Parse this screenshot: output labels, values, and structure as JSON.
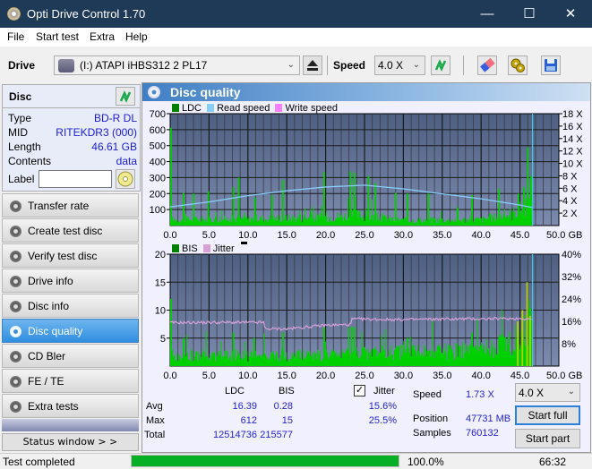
{
  "window": {
    "title": "Opti Drive Control 1.70",
    "minimize": "—",
    "maximize": "☐",
    "close": "✕"
  },
  "menu": [
    "File",
    "Start test",
    "Extra",
    "Help"
  ],
  "toolbar": {
    "drive_label": "Drive",
    "drive_value": "(I:)  ATAPI iHBS312   2 PL17",
    "speed_label": "Speed",
    "speed_value": "4.0 X"
  },
  "disc": {
    "header": "Disc",
    "fields": [
      {
        "key": "Type",
        "value": "BD-R DL"
      },
      {
        "key": "MID",
        "value": "RITEKDR3 (000)"
      },
      {
        "key": "Length",
        "value": "46.61 GB"
      },
      {
        "key": "Contents",
        "value": "data"
      }
    ],
    "label_key": "Label",
    "label_value": ""
  },
  "nav": [
    {
      "label": "Transfer rate",
      "active": false
    },
    {
      "label": "Create test disc",
      "active": false
    },
    {
      "label": "Verify test disc",
      "active": false
    },
    {
      "label": "Drive info",
      "active": false
    },
    {
      "label": "Disc info",
      "active": false
    },
    {
      "label": "Disc quality",
      "active": true
    },
    {
      "label": "CD Bler",
      "active": false
    },
    {
      "label": "FE / TE",
      "active": false
    },
    {
      "label": "Extra tests",
      "active": false
    }
  ],
  "status_window_button": "Status window > >",
  "panel_title": "Disc quality",
  "colors": {
    "ldc": "#008000",
    "bis": "#008000",
    "read_speed": "#87cefa",
    "write_speed": "#ff80ff",
    "jitter": "#d8a0d8",
    "bar_green": "#00d000",
    "plot_bg_top": "#4d5f82",
    "plot_bg_bottom": "#7c8bb0",
    "progress": "#06b025"
  },
  "chart_data": [
    {
      "type": "area",
      "title": "LDC / Read speed",
      "legend": [
        "LDC",
        "Read speed",
        "Write speed"
      ],
      "legend_position": "top-left",
      "xlabel": "GB",
      "x_ticks": [
        "0.0",
        "5.0",
        "10.0",
        "15.0",
        "20.0",
        "25.0",
        "30.0",
        "35.0",
        "40.0",
        "45.0",
        "50.0 GB"
      ],
      "xlim": [
        0,
        50
      ],
      "y_ticks": [
        "700",
        "600",
        "500",
        "400",
        "300",
        "200",
        "100"
      ],
      "ylim": [
        0,
        700
      ],
      "y2_ticks": [
        "18 X",
        "16 X",
        "14 X",
        "12 X",
        "10 X",
        "8 X",
        "6 X",
        "4 X",
        "2 X"
      ],
      "y2lim": [
        0,
        18
      ],
      "grid": true,
      "end_marker_gb": 46.61,
      "ldc_peaks": [
        [
          0.1,
          612
        ],
        [
          1.7,
          205
        ],
        [
          3.0,
          200
        ],
        [
          4.9,
          215
        ],
        [
          8.1,
          240
        ],
        [
          8.8,
          300
        ],
        [
          10.9,
          175
        ],
        [
          13.1,
          190
        ],
        [
          14.5,
          285
        ],
        [
          19.8,
          335
        ],
        [
          23.2,
          340
        ],
        [
          23.7,
          330
        ],
        [
          25.5,
          310
        ],
        [
          26.4,
          265
        ],
        [
          29.0,
          205
        ],
        [
          30.5,
          200
        ],
        [
          33.2,
          200
        ],
        [
          38.8,
          190
        ],
        [
          42.3,
          230
        ],
        [
          44.8,
          200
        ],
        [
          45.5,
          240
        ],
        [
          46.0,
          490
        ],
        [
          46.4,
          310
        ]
      ],
      "ldc_baseline": [
        [
          0,
          40
        ],
        [
          10,
          45
        ],
        [
          20,
          55
        ],
        [
          24,
          70
        ],
        [
          30,
          35
        ],
        [
          40,
          40
        ],
        [
          44,
          80
        ],
        [
          46.6,
          160
        ]
      ],
      "read_speed": [
        [
          0,
          3.0
        ],
        [
          5,
          3.8
        ],
        [
          10,
          4.8
        ],
        [
          15,
          5.6
        ],
        [
          20,
          6.2
        ],
        [
          25,
          6.5
        ],
        [
          30,
          5.9
        ],
        [
          35,
          5.1
        ],
        [
          40,
          4.3
        ],
        [
          45,
          3.3
        ],
        [
          46.6,
          2.9
        ]
      ]
    },
    {
      "type": "area",
      "title": "BIS / Jitter",
      "legend": [
        "BIS",
        "Jitter"
      ],
      "legend_position": "top-left",
      "xlabel": "GB",
      "x_ticks": [
        "0.0",
        "5.0",
        "10.0",
        "15.0",
        "20.0",
        "25.0",
        "30.0",
        "35.0",
        "40.0",
        "45.0",
        "50.0 GB"
      ],
      "xlim": [
        0,
        50
      ],
      "y_ticks": [
        "20",
        "15",
        "10",
        "5"
      ],
      "ylim": [
        0,
        20
      ],
      "y2_ticks": [
        "40%",
        "32%",
        "24%",
        "16%",
        "8%"
      ],
      "y2lim": [
        0,
        40
      ],
      "grid": true,
      "end_marker_gb": 46.61,
      "bis_peaks": [
        [
          0.1,
          12
        ],
        [
          1.7,
          5
        ],
        [
          8.1,
          6
        ],
        [
          10.8,
          5
        ],
        [
          14.5,
          6
        ],
        [
          19.8,
          7
        ],
        [
          23.3,
          7
        ],
        [
          23.7,
          7
        ],
        [
          30.5,
          5
        ],
        [
          38.8,
          6
        ],
        [
          42.3,
          5
        ],
        [
          44.7,
          8
        ],
        [
          45.3,
          10
        ],
        [
          45.9,
          15
        ],
        [
          46.3,
          9
        ]
      ],
      "bis_baseline": [
        [
          0,
          2
        ],
        [
          22,
          2
        ],
        [
          24,
          2.5
        ],
        [
          40,
          3
        ],
        [
          44,
          5
        ],
        [
          46.6,
          8
        ]
      ],
      "jitter": [
        [
          0,
          15.5
        ],
        [
          5,
          15.6
        ],
        [
          12,
          15.6
        ],
        [
          12.2,
          13.3
        ],
        [
          15,
          13.3
        ],
        [
          20,
          14.6
        ],
        [
          23.2,
          14.8
        ],
        [
          23.4,
          16.8
        ],
        [
          30,
          16.6
        ],
        [
          35,
          16.8
        ],
        [
          40,
          16.9
        ],
        [
          45,
          17.0
        ],
        [
          46.6,
          16.8
        ]
      ]
    }
  ],
  "stats": {
    "col_ldc": "LDC",
    "col_bis": "BIS",
    "rows": [
      {
        "label": "Avg",
        "ldc": "16.39",
        "bis": "0.28"
      },
      {
        "label": "Max",
        "ldc": "612",
        "bis": "15"
      },
      {
        "label": "Total",
        "ldc": "12514736",
        "bis": "215577"
      }
    ],
    "jitter_label": "Jitter",
    "jitter_checked": true,
    "jitter_avg": "15.6%",
    "jitter_max": "25.5%",
    "speed_label": "Speed",
    "speed_value": "1.73 X",
    "position_label": "Position",
    "position_value": "47731 MB",
    "samples_label": "Samples",
    "samples_value": "760132",
    "speed_select": "4.0 X",
    "start_full": "Start full",
    "start_part": "Start part"
  },
  "statusbar": {
    "text": "Test completed",
    "progress": 100.0,
    "progress_text": "100.0%",
    "time": "66:32"
  }
}
